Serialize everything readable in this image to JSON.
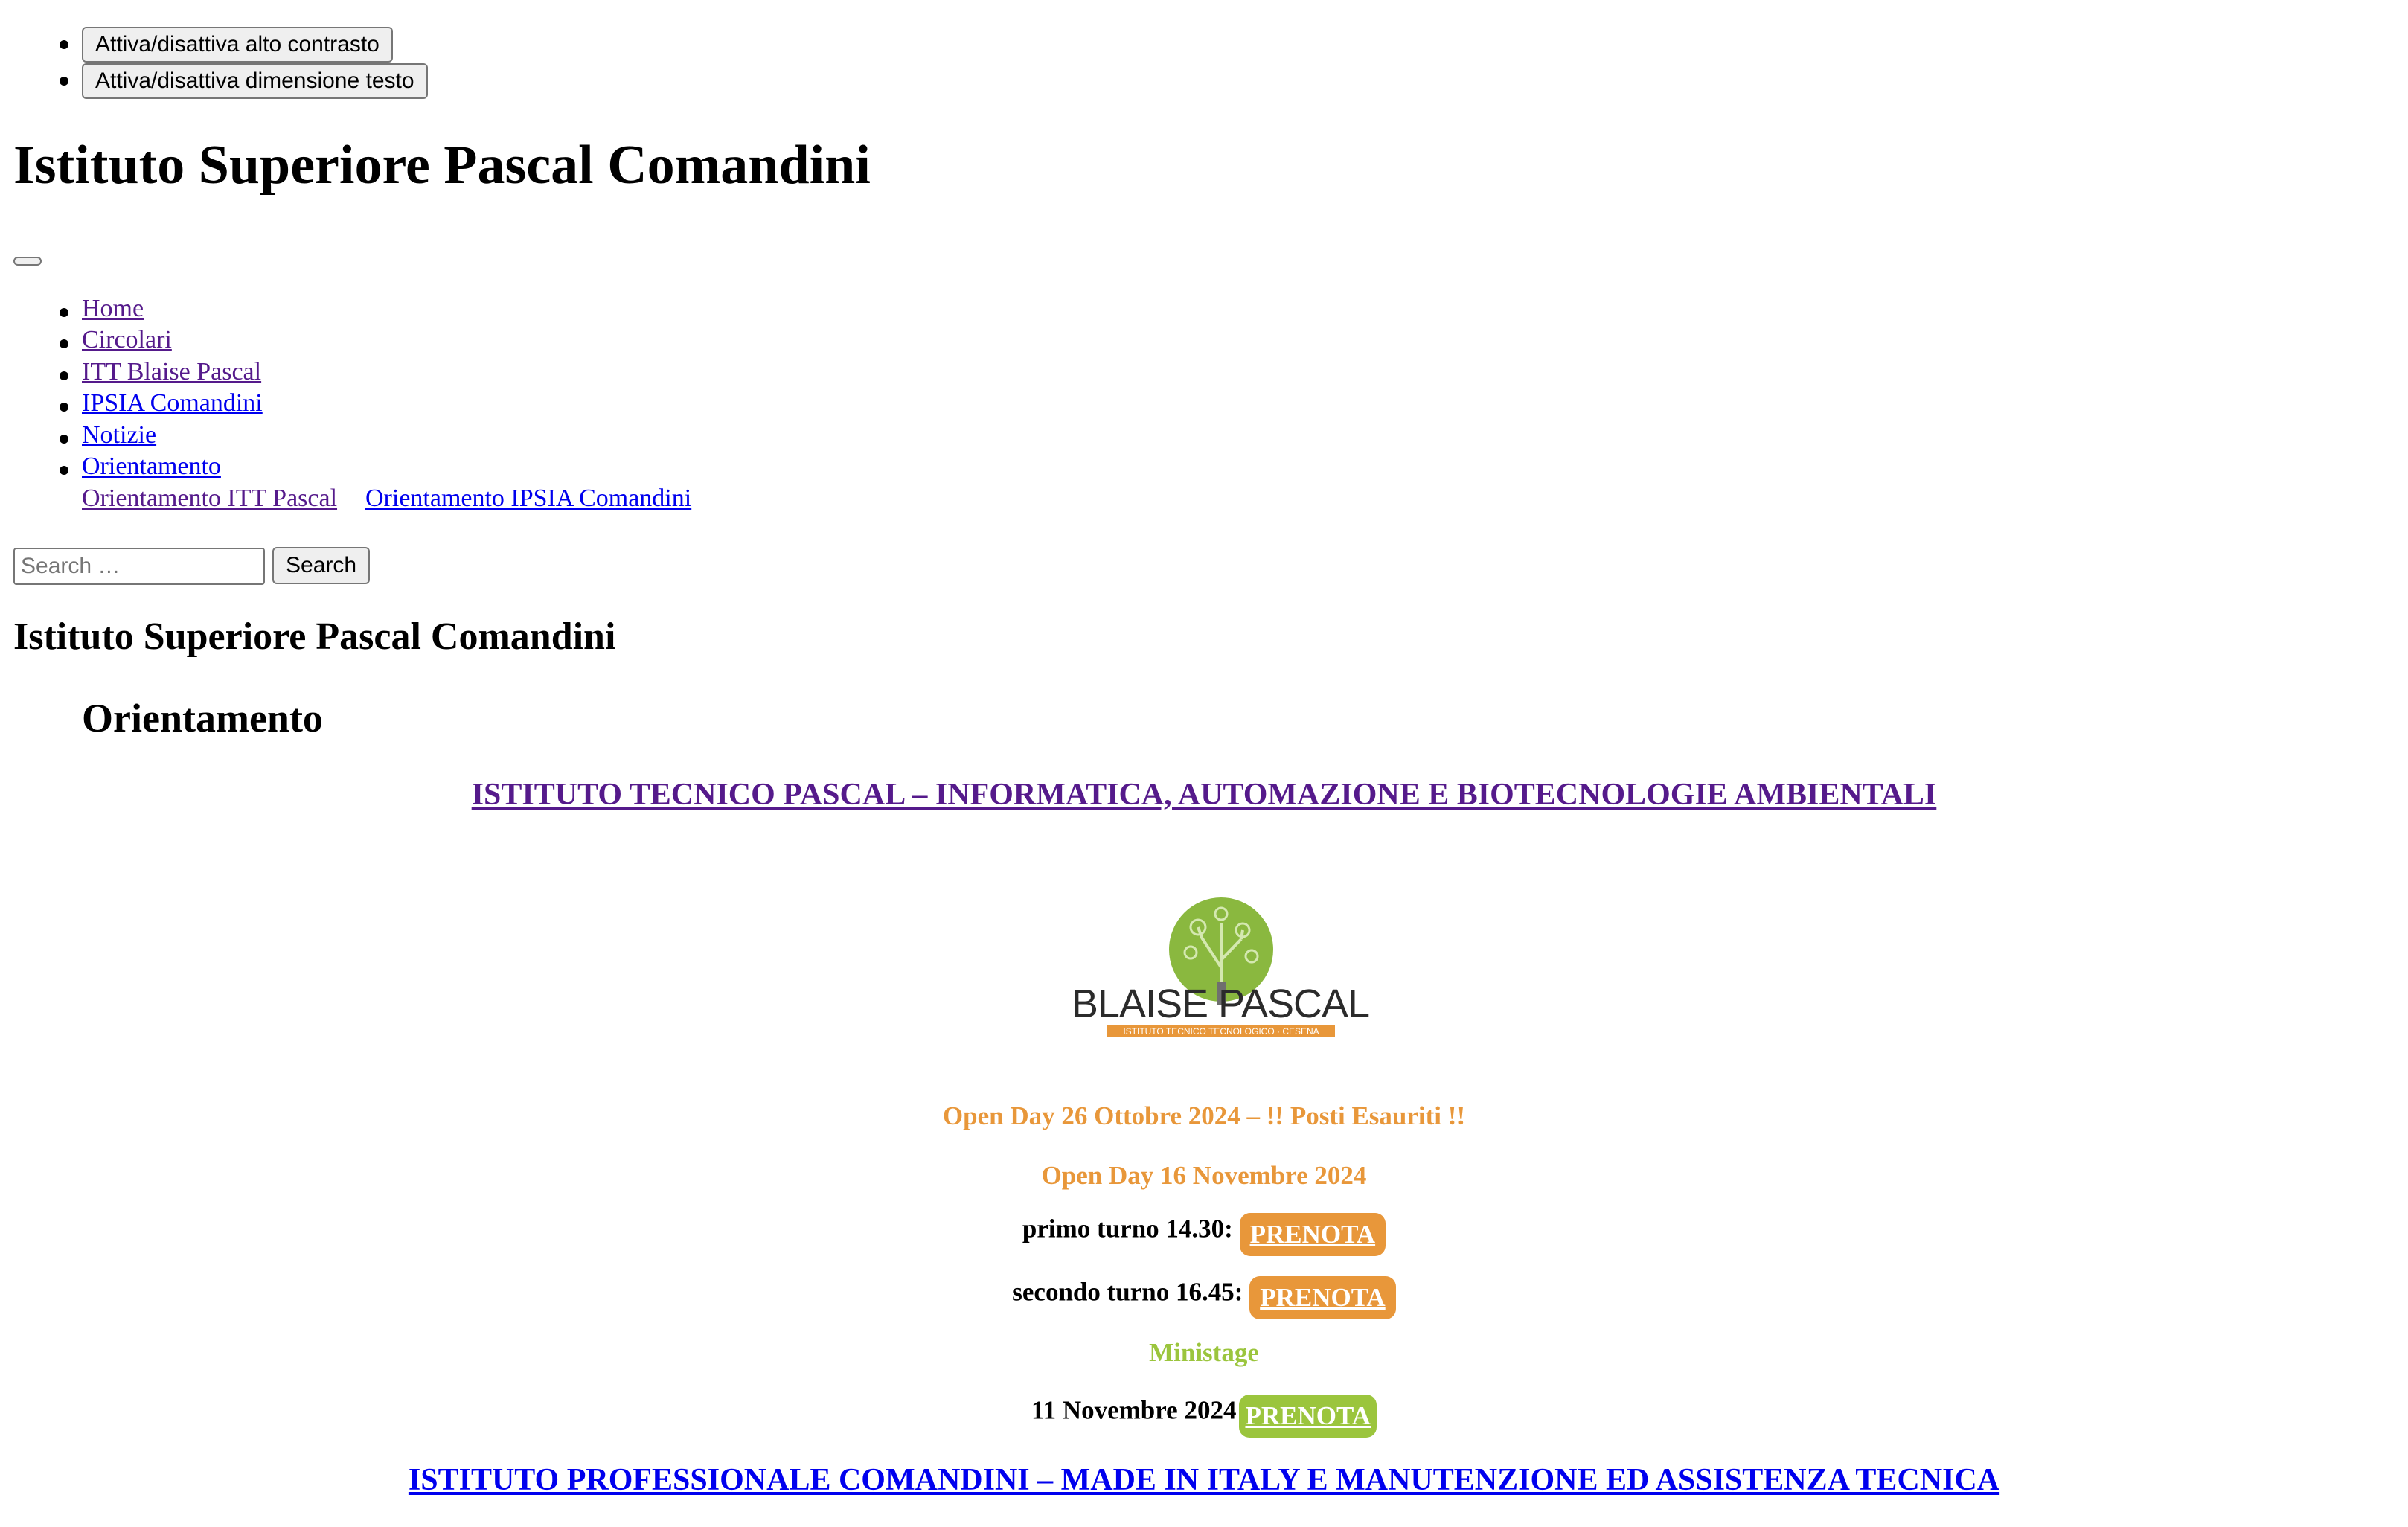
{
  "accessibility": {
    "contrast_button": "Attiva/disattiva alto contrasto",
    "textsize_button": "Attiva/disattiva dimensione testo"
  },
  "site": {
    "title": "Istituto Superiore Pascal Comandini"
  },
  "nav": {
    "items": [
      {
        "label": "Home"
      },
      {
        "label": "Circolari"
      },
      {
        "label": "ITT Blaise Pascal"
      },
      {
        "label": "IPSIA Comandini"
      },
      {
        "label": "Notizie"
      },
      {
        "label": "Orientamento"
      }
    ],
    "submenu": [
      {
        "label": "Orientamento ITT Pascal"
      },
      {
        "label": "Orientamento IPSIA Comandini"
      }
    ]
  },
  "search": {
    "placeholder": "Search …",
    "button": "Search"
  },
  "site_title_2": "Istituto Superiore Pascal Comandini",
  "page": {
    "title": "Orientamento",
    "section1_link": "ISTITUTO TECNICO PASCAL – INFORMATICA, AUTOMAZIONE E BIOTECNOLOGIE AMBIENTALI",
    "logo": {
      "name": "BLAISE PASCAL",
      "tagline": "ISTITUTO TECNICO TECNOLOGICO · CESENA"
    },
    "openday1": "Open Day 26 Ottobre 2024 – !! Posti Esauriti !!",
    "openday2": "Open Day 16 Novembre 2024",
    "turno1_label": "primo turno 14.30",
    "turno2_label": "secondo turno 16.45",
    "prenota": "PRENOTA",
    "ministage_title": "Ministage",
    "ministage_date": "11 Novembre 2024",
    "section2_link": "ISTITUTO PROFESSIONALE COMANDINI – MADE IN ITALY E MANUTENZIONE ED ASSISTENZA TECNICA"
  },
  "colors": {
    "orange": "#e8973a",
    "green": "#9bc53d",
    "link": "#0000ee",
    "visited": "#551a8b"
  }
}
